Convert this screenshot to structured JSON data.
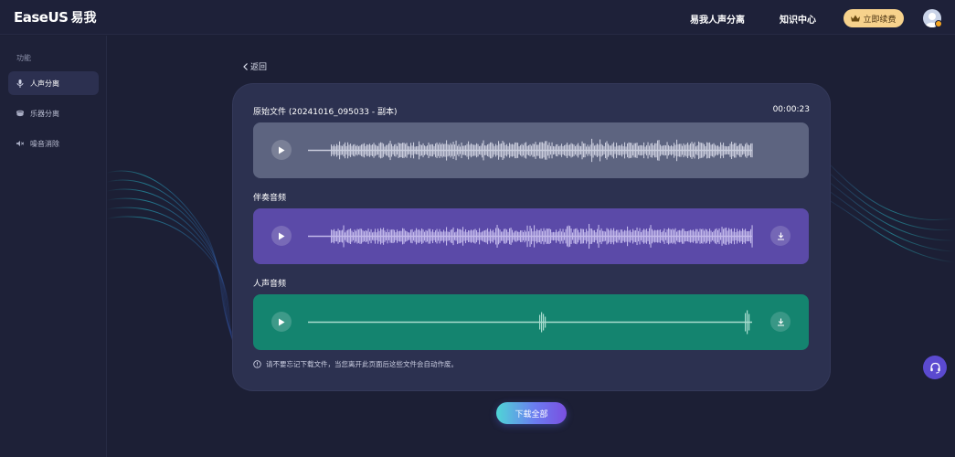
{
  "header": {
    "logo_text": "EaseUS",
    "logo_cn": "易我",
    "nav": [
      "易我人声分离",
      "知识中心"
    ],
    "vip_label": "立即续费",
    "vip_icon": "crown-icon"
  },
  "sidebar": {
    "heading": "功能",
    "items": [
      {
        "label": "人声分离",
        "icon": "microphone-icon",
        "active": true
      },
      {
        "label": "乐器分离",
        "icon": "drum-icon",
        "active": false
      },
      {
        "label": "噪音消除",
        "icon": "noise-icon",
        "active": false
      }
    ]
  },
  "main": {
    "back_label": "返回",
    "original": {
      "label": "原始文件 (20241016_095033 - 副本)",
      "duration": "00:00:23"
    },
    "accompaniment": {
      "label": "伴奏音频"
    },
    "vocals": {
      "label": "人声音频"
    },
    "notice": "请不要忘记下载文件，当您离开此页面后这些文件会自动作废。",
    "download_all_label": "下载全部"
  },
  "colors": {
    "original_track": "#5d6480",
    "accompaniment_track": "#5b4aa8",
    "vocals_track": "#14846f",
    "vip": "#f7d28c",
    "card": "#2c3150"
  }
}
